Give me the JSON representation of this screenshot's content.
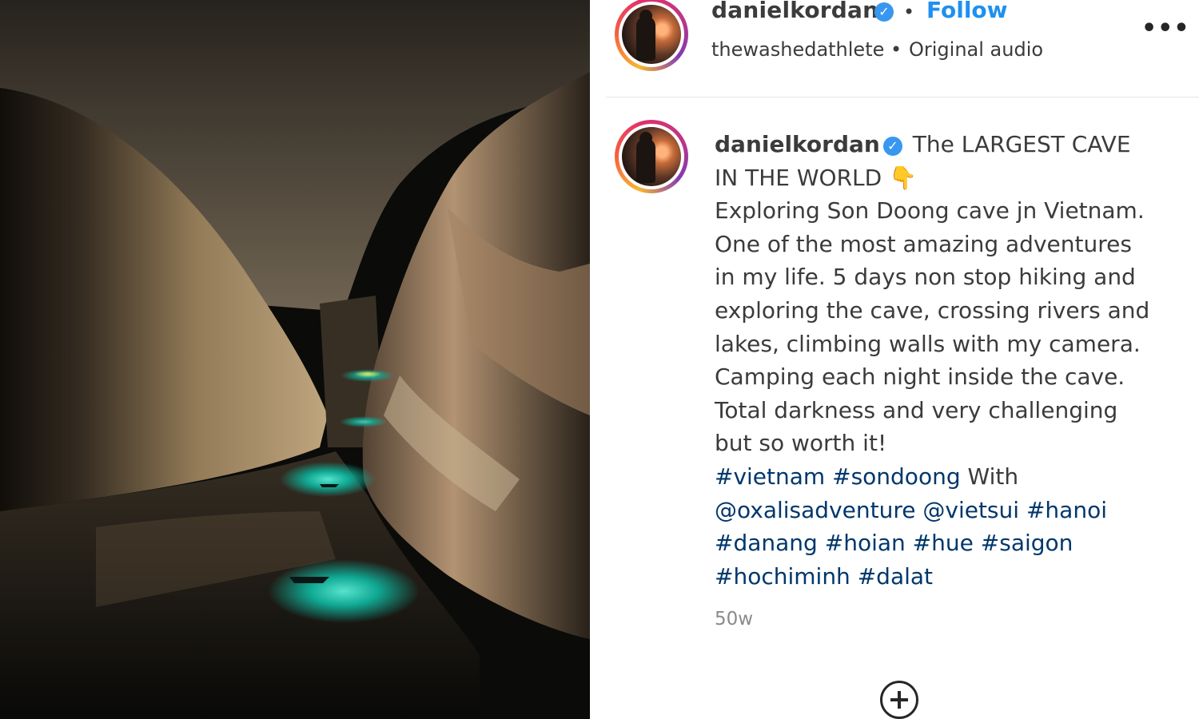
{
  "post": {
    "author": {
      "username": "danielkordan",
      "verified": true,
      "avatar": "profile-photo"
    },
    "follow_label": "Follow",
    "separator": "•",
    "audio": {
      "account": "thewashedathlete",
      "separator": "•",
      "label": "Original audio"
    },
    "more_label": "•••",
    "media": {
      "description_icon": "cave-photo",
      "colors": {
        "water_glow": "#1ad0b8",
        "rock": "#c9a97d",
        "shadow": "#0d0c0a"
      }
    },
    "caption": {
      "username": "danielkordan",
      "lines": [
        "The LARGEST CAVE",
        "IN THE WORLD 👇",
        "Exploring Son Doong cave jn Vietnam.",
        "One of the most amazing adventures",
        "in my life. 5 days non stop hiking and",
        "exploring the cave, crossing rivers and",
        "lakes, climbing walls with my camera.",
        "Camping each night inside the cave.",
        "Total darkness and very challenging",
        "but so worth it!",
        "#vietnam #sondoong With",
        "@oxalisadventure @vietsui #hanoi",
        "#danang #hoian #hue #saigon",
        "#hochiminh #dalat"
      ]
    },
    "timestamp": "50w",
    "add_comment_icon": "plus-circle-icon",
    "colors": {
      "link": "#1e90f0",
      "verified": "#3897f0",
      "text": "#3b3b3b",
      "muted": "#8a8a8a"
    }
  }
}
